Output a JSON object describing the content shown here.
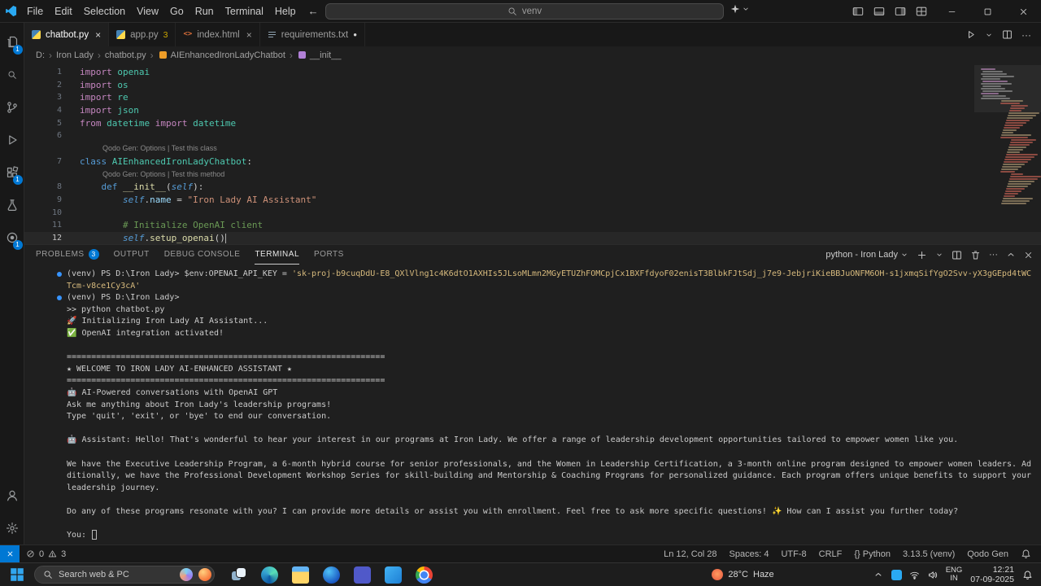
{
  "title_bar": {
    "menus": [
      "File",
      "Edit",
      "Selection",
      "View",
      "Go",
      "Run",
      "Terminal",
      "Help"
    ],
    "search_value": "venv"
  },
  "activity_bar": {
    "top": [
      {
        "icon": "files",
        "name": "explorer",
        "badge": "1"
      },
      {
        "icon": "search",
        "name": "search"
      },
      {
        "icon": "source-control",
        "name": "source-control"
      },
      {
        "icon": "debug",
        "name": "run-and-debug"
      },
      {
        "icon": "extensions",
        "name": "extensions",
        "badge": "1"
      },
      {
        "icon": "flask",
        "name": "testing"
      },
      {
        "icon": "qodo",
        "name": "qodo-gen",
        "badge": "1"
      }
    ],
    "bottom": [
      {
        "icon": "account",
        "name": "accounts"
      },
      {
        "icon": "gear",
        "name": "settings"
      }
    ]
  },
  "editor_tabs": [
    {
      "label": "chatbot.py",
      "icon": "python",
      "active": true
    },
    {
      "label": "app.py",
      "icon": "python",
      "badge": "3"
    },
    {
      "label": "index.html",
      "icon": "html"
    },
    {
      "label": "requirements.txt",
      "icon": "txt",
      "modified": true
    }
  ],
  "breadcrumb": [
    {
      "label": "D:"
    },
    {
      "label": "Iron Lady"
    },
    {
      "label": "chatbot.py"
    },
    {
      "label": "AIEnhancedIronLadyChatbot",
      "icon": "symbol-class"
    },
    {
      "label": "__init__",
      "icon": "symbol-method"
    }
  ],
  "editor": {
    "lines": [
      {
        "n": "1",
        "tokens": [
          [
            "kw",
            "import"
          ],
          [
            "pl",
            " "
          ],
          [
            "mod",
            "openai"
          ]
        ]
      },
      {
        "n": "2",
        "tokens": [
          [
            "kw",
            "import"
          ],
          [
            "pl",
            " "
          ],
          [
            "mod",
            "os"
          ]
        ]
      },
      {
        "n": "3",
        "tokens": [
          [
            "kw",
            "import"
          ],
          [
            "pl",
            " "
          ],
          [
            "mod",
            "re"
          ]
        ]
      },
      {
        "n": "4",
        "tokens": [
          [
            "kw",
            "import"
          ],
          [
            "pl",
            " "
          ],
          [
            "mod",
            "json"
          ]
        ]
      },
      {
        "n": "5",
        "tokens": [
          [
            "kw",
            "from"
          ],
          [
            "pl",
            " "
          ],
          [
            "mod",
            "datetime"
          ],
          [
            "pl",
            " "
          ],
          [
            "kw",
            "import"
          ],
          [
            "pl",
            " "
          ],
          [
            "cls",
            "datetime"
          ]
        ]
      },
      {
        "n": "6",
        "tokens": []
      },
      {
        "lens": "Qodo Gen: Options | Test this class"
      },
      {
        "n": "7",
        "tokens": [
          [
            "kw2",
            "class"
          ],
          [
            "pl",
            " "
          ],
          [
            "cls",
            "AIEnhancedIronLadyChatbot"
          ],
          [
            "pl",
            ":"
          ]
        ]
      },
      {
        "lens": "Qodo Gen: Options | Test this method"
      },
      {
        "n": "8",
        "tokens": [
          [
            "pl",
            "    "
          ],
          [
            "kw2",
            "def"
          ],
          [
            "pl",
            " "
          ],
          [
            "fn",
            "__init__"
          ],
          [
            "pl",
            "("
          ],
          [
            "slf",
            "self"
          ],
          [
            "pl",
            "):"
          ]
        ]
      },
      {
        "n": "9",
        "tokens": [
          [
            "pl",
            "        "
          ],
          [
            "slf",
            "self"
          ],
          [
            "pl",
            "."
          ],
          [
            "prp",
            "name"
          ],
          [
            "pl",
            " = "
          ],
          [
            "str",
            "\"Iron Lady AI Assistant\""
          ]
        ]
      },
      {
        "n": "10",
        "tokens": []
      },
      {
        "n": "11",
        "tokens": [
          [
            "pl",
            "        "
          ],
          [
            "cmt",
            "# Initialize OpenAI client"
          ]
        ]
      },
      {
        "n": "12",
        "current": true,
        "tokens": [
          [
            "pl",
            "        "
          ],
          [
            "slf",
            "self"
          ],
          [
            "pl",
            "."
          ],
          [
            "fn",
            "setup_openai"
          ],
          [
            "pl",
            "()"
          ]
        ]
      }
    ]
  },
  "panel": {
    "tabs": [
      {
        "label": "PROBLEMS",
        "badge": "3"
      },
      {
        "label": "OUTPUT"
      },
      {
        "label": "DEBUG CONSOLE"
      },
      {
        "label": "TERMINAL",
        "active": true
      },
      {
        "label": "PORTS"
      }
    ],
    "profile": "python - Iron Lady",
    "terminal_lines": [
      {
        "deco": true,
        "segs": [
          [
            "p",
            "(venv) PS D:\\Iron Lady> "
          ],
          [
            "t",
            "$env:OPENAI_API_KEY = "
          ],
          [
            "s",
            "'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'"
          ]
        ]
      },
      {
        "deco": true,
        "segs": [
          [
            "p",
            "(venv) PS D:\\Iron Lady> "
          ]
        ]
      },
      {
        "segs": [
          [
            "t",
            ">> python chatbot.py"
          ]
        ]
      },
      {
        "segs": [
          [
            "t",
            "🚀 Initializing Iron Lady AI Assistant..."
          ]
        ]
      },
      {
        "segs": [
          [
            "t",
            "✅ OpenAI integration activated!"
          ]
        ]
      },
      {
        "segs": []
      },
      {
        "segs": [
          [
            "t",
            "================================================================="
          ]
        ]
      },
      {
        "segs": [
          [
            "t",
            "★ WELCOME TO IRON LADY AI-ENHANCED ASSISTANT ★"
          ]
        ]
      },
      {
        "segs": [
          [
            "t",
            "================================================================="
          ]
        ]
      },
      {
        "segs": [
          [
            "t",
            "🤖 AI-Powered conversations with OpenAI GPT"
          ]
        ]
      },
      {
        "segs": [
          [
            "t",
            "Ask me anything about Iron Lady's leadership programs!"
          ]
        ]
      },
      {
        "segs": [
          [
            "t",
            "Type 'quit', 'exit', or 'bye' to end our conversation."
          ]
        ]
      },
      {
        "segs": []
      },
      {
        "segs": [
          [
            "t",
            "🤖 Assistant: Hello! That's wonderful to hear your interest in our programs at Iron Lady. We offer a range of leadership development opportunities tailored to empower women like you."
          ]
        ]
      },
      {
        "segs": []
      },
      {
        "segs": [
          [
            "t",
            "We have the Executive Leadership Program, a 6-month hybrid course for senior professionals, and the Women in Leadership Certification, a 3-month online program designed to empower women leaders. Additionally, we have the Professional Development Workshop Series for skill-building and Mentorship & Coaching Programs for personalized guidance. Each program offers unique benefits to support your leadership journey."
          ]
        ]
      },
      {
        "segs": []
      },
      {
        "segs": [
          [
            "t",
            "Do any of these programs resonate with you? I can provide more details or assist you with enrollment. Feel free to ask more specific questions! ✨ How can I assist you further today?"
          ]
        ]
      },
      {
        "segs": []
      },
      {
        "cursor": true,
        "segs": [
          [
            "t",
            "You: "
          ]
        ]
      }
    ]
  },
  "status_bar": {
    "errors": "0",
    "warnings": "3",
    "right": [
      "Ln 12, Col 28",
      "Spaces: 4",
      "UTF-8",
      "CRLF",
      "{} Python",
      "3.13.5 (venv)",
      "Qodo Gen"
    ]
  },
  "taskbar": {
    "search_text": "Search web & PC",
    "apps": [
      "task-view",
      "edge",
      "file-explorer",
      "copilot",
      "teams",
      "vscode",
      "chrome"
    ],
    "weather_temp": "28°C",
    "weather_cond": "Haze",
    "lang_top": "ENG",
    "lang_bottom": "IN",
    "time": "12:21",
    "date": "07-09-2025"
  }
}
